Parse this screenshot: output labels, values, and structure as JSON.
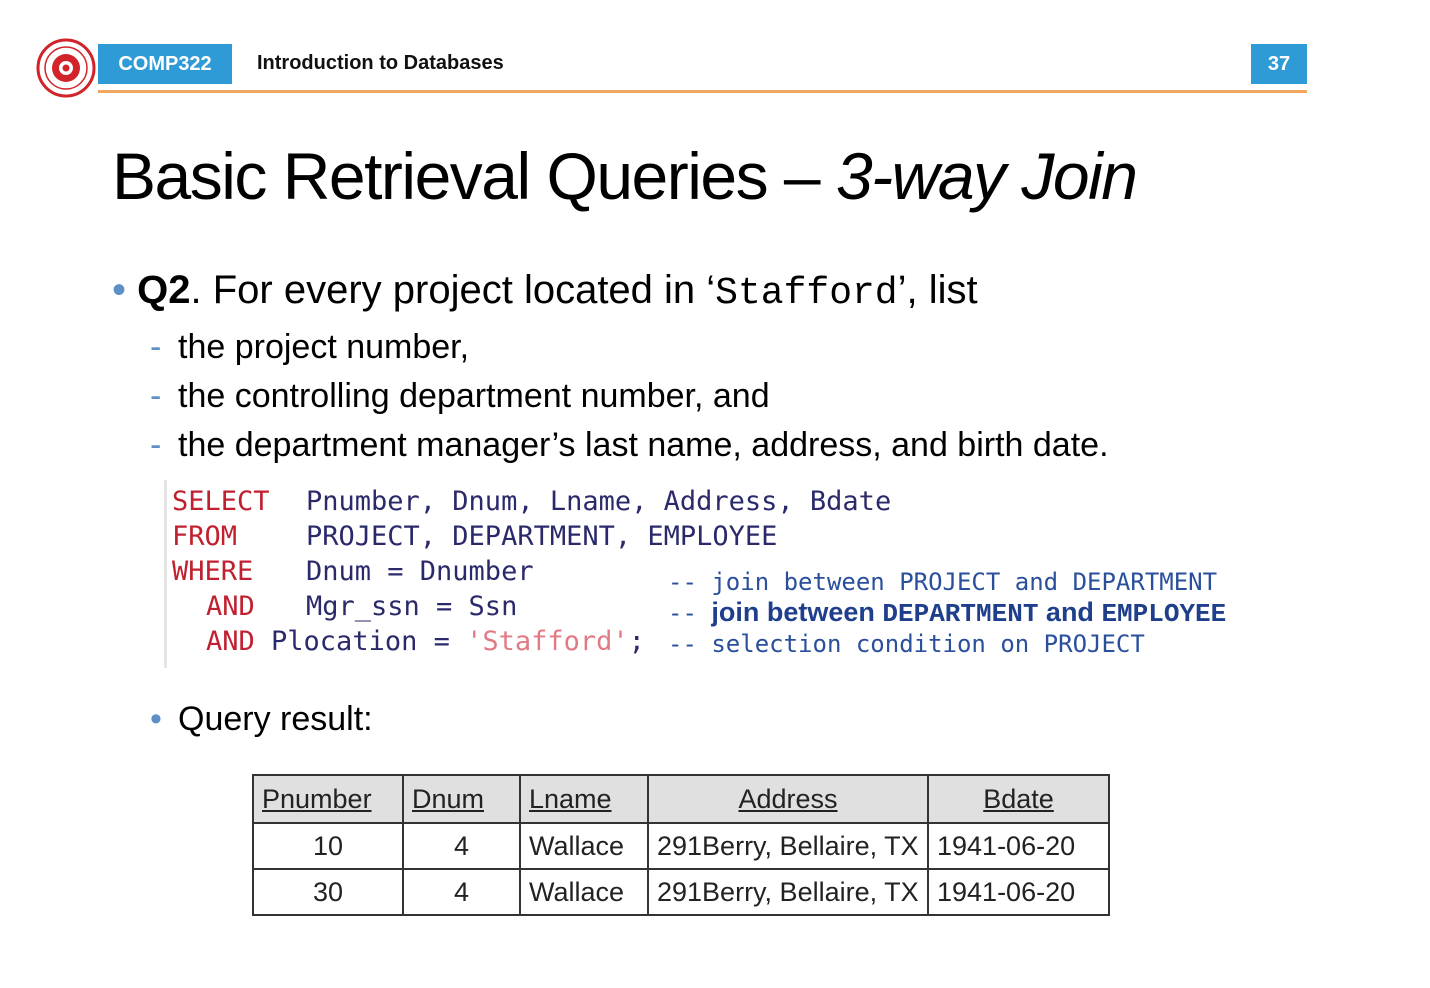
{
  "header": {
    "logo_icon": "university-seal-icon",
    "course_code": "COMP322",
    "course_title": "Introduction to Databases",
    "page_number": "37",
    "accent_color": "#2f9bd6",
    "rule_color": "#f0a860"
  },
  "title": {
    "main": "Basic Retrieval Queries – ",
    "emphasis": "3-way Join"
  },
  "question": {
    "bullet": "•",
    "id": "Q2",
    "text_before": ". For every project located in ‘",
    "code": "Stafford",
    "text_after": "’, list",
    "items": [
      {
        "dash": "-",
        "text": "the project number,"
      },
      {
        "dash": "-",
        "text": "the controlling department number, and"
      },
      {
        "dash": "-",
        "text": "the department manager’s last name, address, and birth date."
      }
    ]
  },
  "sql": {
    "line1_kw": "SELECT",
    "line1_rest": "Pnumber, Dnum, Lname, Address, Bdate",
    "line2_kw": "FROM",
    "line2_rest": "PROJECT, DEPARTMENT, EMPLOYEE",
    "line3_kw": "WHERE",
    "line3_rest": "Dnum = Dnumber",
    "line4_kw": "AND",
    "line4_rest": "Mgr_ssn = Ssn",
    "line5_kw": "AND",
    "line5_rest": " Plocation = ",
    "line5_str": "'Stafford'",
    "line5_end": ";",
    "comment1": "-- join between PROJECT and DEPARTMENT",
    "comment2_prefix": "-- ",
    "comment2_a": "join between ",
    "comment2_m1": "DEPARTMENT",
    "comment2_b": " and ",
    "comment2_m2": "EMPLOYEE",
    "comment3": "-- selection condition on PROJECT"
  },
  "result": {
    "bullet": "•",
    "label": "Query result:",
    "columns": [
      "Pnumber",
      "Dnum",
      "Lname",
      "Address",
      "Bdate"
    ],
    "rows": [
      [
        "10",
        "4",
        "Wallace",
        "291Berry, Bellaire, TX",
        "1941-06-20"
      ],
      [
        "30",
        "4",
        "Wallace",
        "291Berry, Bellaire, TX",
        "1941-06-20"
      ]
    ]
  }
}
